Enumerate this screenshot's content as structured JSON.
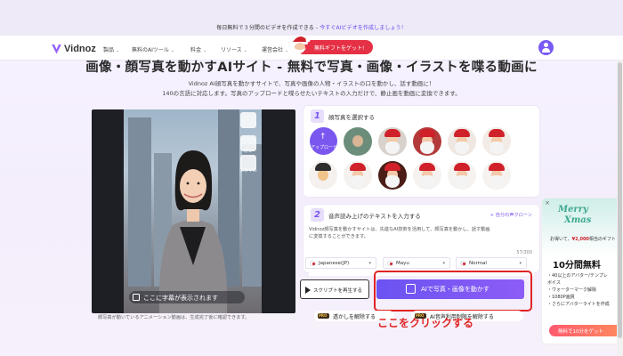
{
  "promo": {
    "text": "毎日無料で３分間のビデオを作成できる - ",
    "link": "今すぐAIビデオを作成しましょう！"
  },
  "nav": {
    "logo": "Vidnoz",
    "items": [
      {
        "label": "製品"
      },
      {
        "label": "無料のAIツール"
      },
      {
        "label": "料金"
      },
      {
        "label": "リソース"
      },
      {
        "label": "運営会社"
      }
    ],
    "gift_label": "無料ギフトをゲット!"
  },
  "hero": {
    "title": "画像・顔写真を動かすAIサイト - 無料で写真・画像・イラストを喋る動画に",
    "subtitle_lines": [
      "Vidnoz AI顔写真を動かすサイトで、写真や画像の人物・イラストの口を動かし、話す動画に！",
      "140の言語に対応します。写真のアップロードと喋らせたいテキストの入力だけで、静止画を動画に変換できます。"
    ]
  },
  "preview": {
    "tools": [
      {
        "label": ""
      },
      {
        "label": "オン"
      },
      {
        "label": "スタイル"
      }
    ],
    "caption": "ここに字幕が表示されます",
    "disclaimer": "顔写真が動いているアニメーション動画は、生成完了後に確認できます。"
  },
  "step1": {
    "num": "1",
    "title": "顔写真を選択する",
    "upload_label": "アップロード"
  },
  "step2": {
    "num": "2",
    "title": "音声読み上げのテキストを入力する",
    "dub_link": "自分の声クローン",
    "text_lines": [
      "Vidnoz顔写真を動かすサイトは、先進なAI技術を活用して、顔写真を動かし、話す動画",
      "に変換することができます。"
    ],
    "counter": "57/300",
    "language": "Japanese(JP)",
    "voice": "Mayu",
    "style": "Normal"
  },
  "actions": {
    "play_label": "スクリプトを再生する",
    "animate_label": "AIで写真・画像を動かす",
    "pro_watermark": "透かしを解除する",
    "pro_voice": "AI音声利用制限を解除する",
    "annotation": "ここをクリックする"
  },
  "xmas": {
    "title_1": "Merry",
    "title_2": "Xmas",
    "sub_prefix": "お得いて、",
    "sub_amount": "¥2,000",
    "sub_suffix": "相当のギフト",
    "big": "10分間無料",
    "list": [
      "・40以上のアバター/テンプレ",
      "ボイス",
      "・ウォーターマーク解除",
      "・1080P画質",
      "・さらにアバターライトを作成"
    ],
    "cta": "無料で10分をゲット"
  },
  "colors": {
    "accent": "#7a57ef",
    "annotation": "#e02424",
    "gift": "#e53045"
  }
}
